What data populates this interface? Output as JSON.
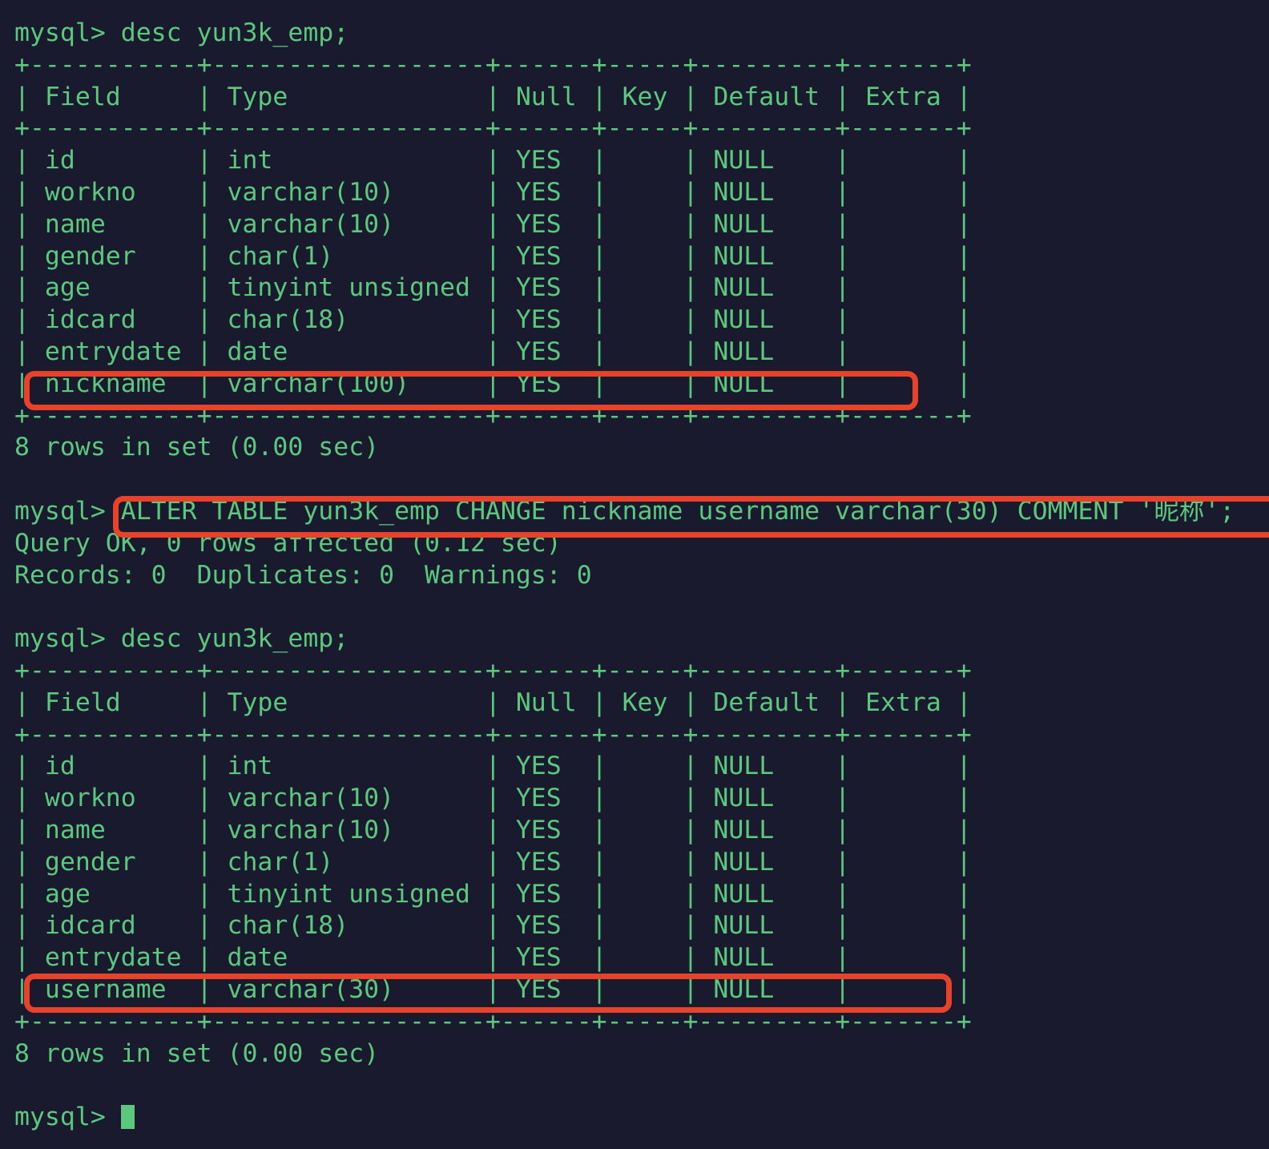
{
  "terminal": {
    "prompt": "mysql> ",
    "colors": {
      "background": "#191a2e",
      "text": "#5cc87d",
      "highlight": "#e8432a",
      "cursor": "#5cc87d"
    },
    "lines": [
      {
        "id": "l01",
        "text": "mysql> desc yun3k_emp;"
      },
      {
        "id": "l02",
        "text": "+-----------+------------------+------+-----+---------+-------+"
      },
      {
        "id": "l03",
        "text": "| Field     | Type             | Null | Key | Default | Extra |"
      },
      {
        "id": "l04",
        "text": "+-----------+------------------+------+-----+---------+-------+"
      },
      {
        "id": "l05",
        "text": "| id        | int              | YES  |     | NULL    |       |"
      },
      {
        "id": "l06",
        "text": "| workno    | varchar(10)      | YES  |     | NULL    |       |"
      },
      {
        "id": "l07",
        "text": "| name      | varchar(10)      | YES  |     | NULL    |       |"
      },
      {
        "id": "l08",
        "text": "| gender    | char(1)          | YES  |     | NULL    |       |"
      },
      {
        "id": "l09",
        "text": "| age       | tinyint unsigned | YES  |     | NULL    |       |"
      },
      {
        "id": "l10",
        "text": "| idcard    | char(18)         | YES  |     | NULL    |       |"
      },
      {
        "id": "l11",
        "text": "| entrydate | date             | YES  |     | NULL    |       |"
      },
      {
        "id": "l12",
        "text": "| nickname  | varchar(100)     | YES  |     | NULL    |       |"
      },
      {
        "id": "l13",
        "text": "+-----------+------------------+------+-----+---------+-------+"
      },
      {
        "id": "l14",
        "text": "8 rows in set (0.00 sec)"
      },
      {
        "id": "l15",
        "text": ""
      },
      {
        "id": "l16",
        "text": "mysql> ALTER TABLE yun3k_emp CHANGE nickname username varchar(30) COMMENT '昵称';"
      },
      {
        "id": "l17",
        "text": "Query OK, 0 rows affected (0.12 sec)"
      },
      {
        "id": "l18",
        "text": "Records: 0  Duplicates: 0  Warnings: 0"
      },
      {
        "id": "l19",
        "text": ""
      },
      {
        "id": "l20",
        "text": "mysql> desc yun3k_emp;"
      },
      {
        "id": "l21",
        "text": "+-----------+------------------+------+-----+---------+-------+"
      },
      {
        "id": "l22",
        "text": "| Field     | Type             | Null | Key | Default | Extra |"
      },
      {
        "id": "l23",
        "text": "+-----------+------------------+------+-----+---------+-------+"
      },
      {
        "id": "l24",
        "text": "| id        | int              | YES  |     | NULL    |       |"
      },
      {
        "id": "l25",
        "text": "| workno    | varchar(10)      | YES  |     | NULL    |       |"
      },
      {
        "id": "l26",
        "text": "| name      | varchar(10)      | YES  |     | NULL    |       |"
      },
      {
        "id": "l27",
        "text": "| gender    | char(1)          | YES  |     | NULL    |       |"
      },
      {
        "id": "l28",
        "text": "| age       | tinyint unsigned | YES  |     | NULL    |       |"
      },
      {
        "id": "l29",
        "text": "| idcard    | char(18)         | YES  |     | NULL    |       |"
      },
      {
        "id": "l30",
        "text": "| entrydate | date             | YES  |     | NULL    |       |"
      },
      {
        "id": "l31",
        "text": "| username  | varchar(30)      | YES  |     | NULL    |       |"
      },
      {
        "id": "l32",
        "text": "+-----------+------------------+------+-----+---------+-------+"
      },
      {
        "id": "l33",
        "text": "8 rows in set (0.00 sec)"
      },
      {
        "id": "l34",
        "text": ""
      },
      {
        "id": "l35",
        "text": "mysql> "
      }
    ],
    "commands": [
      {
        "id": "cmd1",
        "text": "desc yun3k_emp;"
      },
      {
        "id": "cmd2",
        "text": "ALTER TABLE yun3k_emp CHANGE nickname username varchar(30) COMMENT '昵称';"
      },
      {
        "id": "cmd3",
        "text": "desc yun3k_emp;"
      }
    ],
    "tables": [
      {
        "id": "table-before",
        "headers": [
          "Field",
          "Type",
          "Null",
          "Key",
          "Default",
          "Extra"
        ],
        "rows": [
          [
            "id",
            "int",
            "YES",
            "",
            "NULL",
            ""
          ],
          [
            "workno",
            "varchar(10)",
            "YES",
            "",
            "NULL",
            ""
          ],
          [
            "name",
            "varchar(10)",
            "YES",
            "",
            "NULL",
            ""
          ],
          [
            "gender",
            "char(1)",
            "YES",
            "",
            "NULL",
            ""
          ],
          [
            "age",
            "tinyint unsigned",
            "YES",
            "",
            "NULL",
            ""
          ],
          [
            "idcard",
            "char(18)",
            "YES",
            "",
            "NULL",
            ""
          ],
          [
            "entrydate",
            "date",
            "YES",
            "",
            "NULL",
            ""
          ],
          [
            "nickname",
            "varchar(100)",
            "YES",
            "",
            "NULL",
            ""
          ]
        ],
        "footer": "8 rows in set (0.00 sec)"
      },
      {
        "id": "table-after",
        "headers": [
          "Field",
          "Type",
          "Null",
          "Key",
          "Default",
          "Extra"
        ],
        "rows": [
          [
            "id",
            "int",
            "YES",
            "",
            "NULL",
            ""
          ],
          [
            "workno",
            "varchar(10)",
            "YES",
            "",
            "NULL",
            ""
          ],
          [
            "name",
            "varchar(10)",
            "YES",
            "",
            "NULL",
            ""
          ],
          [
            "gender",
            "char(1)",
            "YES",
            "",
            "NULL",
            ""
          ],
          [
            "age",
            "tinyint unsigned",
            "YES",
            "",
            "NULL",
            ""
          ],
          [
            "idcard",
            "char(18)",
            "YES",
            "",
            "NULL",
            ""
          ],
          [
            "entrydate",
            "date",
            "YES",
            "",
            "NULL",
            ""
          ],
          [
            "username",
            "varchar(30)",
            "YES",
            "",
            "NULL",
            ""
          ]
        ],
        "footer": "8 rows in set (0.00 sec)"
      }
    ],
    "query_result": {
      "status": "Query OK, 0 rows affected (0.12 sec)",
      "counters": "Records: 0  Duplicates: 0  Warnings: 0"
    },
    "highlights": [
      {
        "id": "hl-nickname-row",
        "label": "nickname row"
      },
      {
        "id": "hl-alter-command",
        "label": "ALTER TABLE statement"
      },
      {
        "id": "hl-username-row",
        "label": "username row"
      }
    ]
  }
}
